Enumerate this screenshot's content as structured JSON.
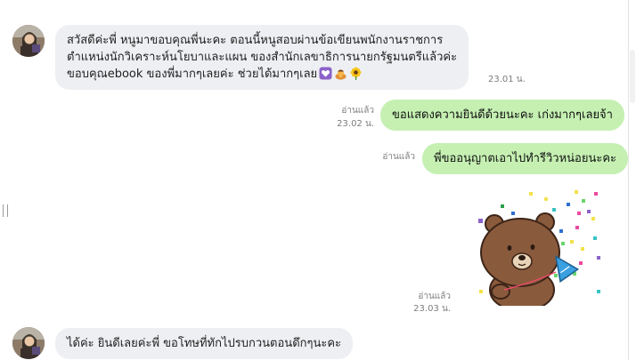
{
  "messages": [
    {
      "lines": [
        "สวัสดีค่ะพี่ หนูมาขอบคุณพี่นะคะ ตอนนี้หนูสอบผ่านข้อเขียนพนักงานราชการ",
        "ตำแหน่งนักวิเคราะห์นโยบาและแผน ของสำนักเลขาธิการนายกรัฐมนตรีแล้วค่ะ",
        "ขอบคุณebook ของพี่มากๆเลยค่ะ ช่วยได้มากๆเลย"
      ],
      "emojis": [
        "heart-icon",
        "bowing-person-icon",
        "sunflower-icon"
      ],
      "time": "23.01 น."
    },
    {
      "text": "ขอแสดงความยินดีด้วยนะคะ เก่งมากๆเลยจ้า",
      "read": "อ่านแล้ว",
      "time": "23.02 น."
    },
    {
      "text": "พี่ขออนุญาตเอาไปทำรีวิวหน่อยนะคะ",
      "read": "อ่านแล้ว"
    },
    {
      "sticker": "brown-bear-celebration-sticker",
      "read": "อ่านแล้ว",
      "time": "23.03 น."
    },
    {
      "text": "ได้ค่ะ ยินดีเลยค่ะพี่ ขอโทษที่ทักไปรบกวนตอนดึกๆนะคะ"
    }
  ],
  "colors": {
    "incoming_bubble": "#eeeff2",
    "outgoing_bubble": "#c5f0b2",
    "meta_text": "#7d7d7d"
  }
}
